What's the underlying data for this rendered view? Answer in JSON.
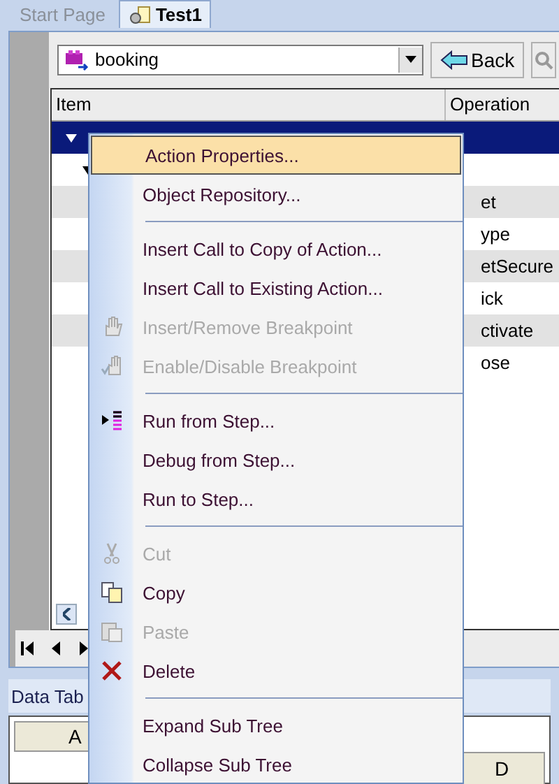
{
  "tabs": [
    {
      "label": "Start Page",
      "selected": false
    },
    {
      "label": "Test1",
      "selected": true
    }
  ],
  "toolbar": {
    "action_combo": {
      "value": "booking"
    },
    "back_button": "Back"
  },
  "grid": {
    "columns": [
      "Item",
      "Operation"
    ],
    "rows": [
      {
        "selected": true,
        "expander": true
      },
      {
        "selected": false,
        "expander": true
      },
      {
        "selected": false,
        "operation": "et"
      },
      {
        "selected": false,
        "operation": "ype"
      },
      {
        "selected": false,
        "operation": "etSecure"
      },
      {
        "selected": false,
        "operation": "ick"
      },
      {
        "selected": false,
        "operation": "ctivate"
      },
      {
        "selected": false,
        "operation": "ose"
      }
    ]
  },
  "data_table": {
    "title": "Data Tab",
    "column_headers": [
      "A",
      "D"
    ]
  },
  "context_menu": [
    {
      "kind": "item",
      "label": "Action Properties...",
      "selected": true,
      "disabled": false
    },
    {
      "kind": "item",
      "label": "Object Repository...",
      "selected": false,
      "disabled": false
    },
    {
      "kind": "separator"
    },
    {
      "kind": "item",
      "label": "Insert Call to Copy of Action...",
      "selected": false,
      "disabled": false
    },
    {
      "kind": "item",
      "label": "Insert Call to Existing Action...",
      "selected": false,
      "disabled": false
    },
    {
      "kind": "item",
      "label": "Insert/Remove Breakpoint",
      "selected": false,
      "disabled": true
    },
    {
      "kind": "item",
      "label": "Enable/Disable Breakpoint",
      "selected": false,
      "disabled": true
    },
    {
      "kind": "separator"
    },
    {
      "kind": "item",
      "label": "Run from Step...",
      "selected": false,
      "disabled": false
    },
    {
      "kind": "item",
      "label": "Debug from Step...",
      "selected": false,
      "disabled": false
    },
    {
      "kind": "item",
      "label": "Run to Step...",
      "selected": false,
      "disabled": false
    },
    {
      "kind": "separator"
    },
    {
      "kind": "item",
      "label": "Cut",
      "selected": false,
      "disabled": true
    },
    {
      "kind": "item",
      "label": "Copy",
      "selected": false,
      "disabled": false
    },
    {
      "kind": "item",
      "label": "Paste",
      "selected": false,
      "disabled": true
    },
    {
      "kind": "item",
      "label": "Delete",
      "selected": false,
      "disabled": false
    },
    {
      "kind": "separator"
    },
    {
      "kind": "item",
      "label": "Expand Sub Tree",
      "selected": false,
      "disabled": false
    },
    {
      "kind": "item",
      "label": "Collapse Sub Tree",
      "selected": false,
      "disabled": false
    }
  ]
}
